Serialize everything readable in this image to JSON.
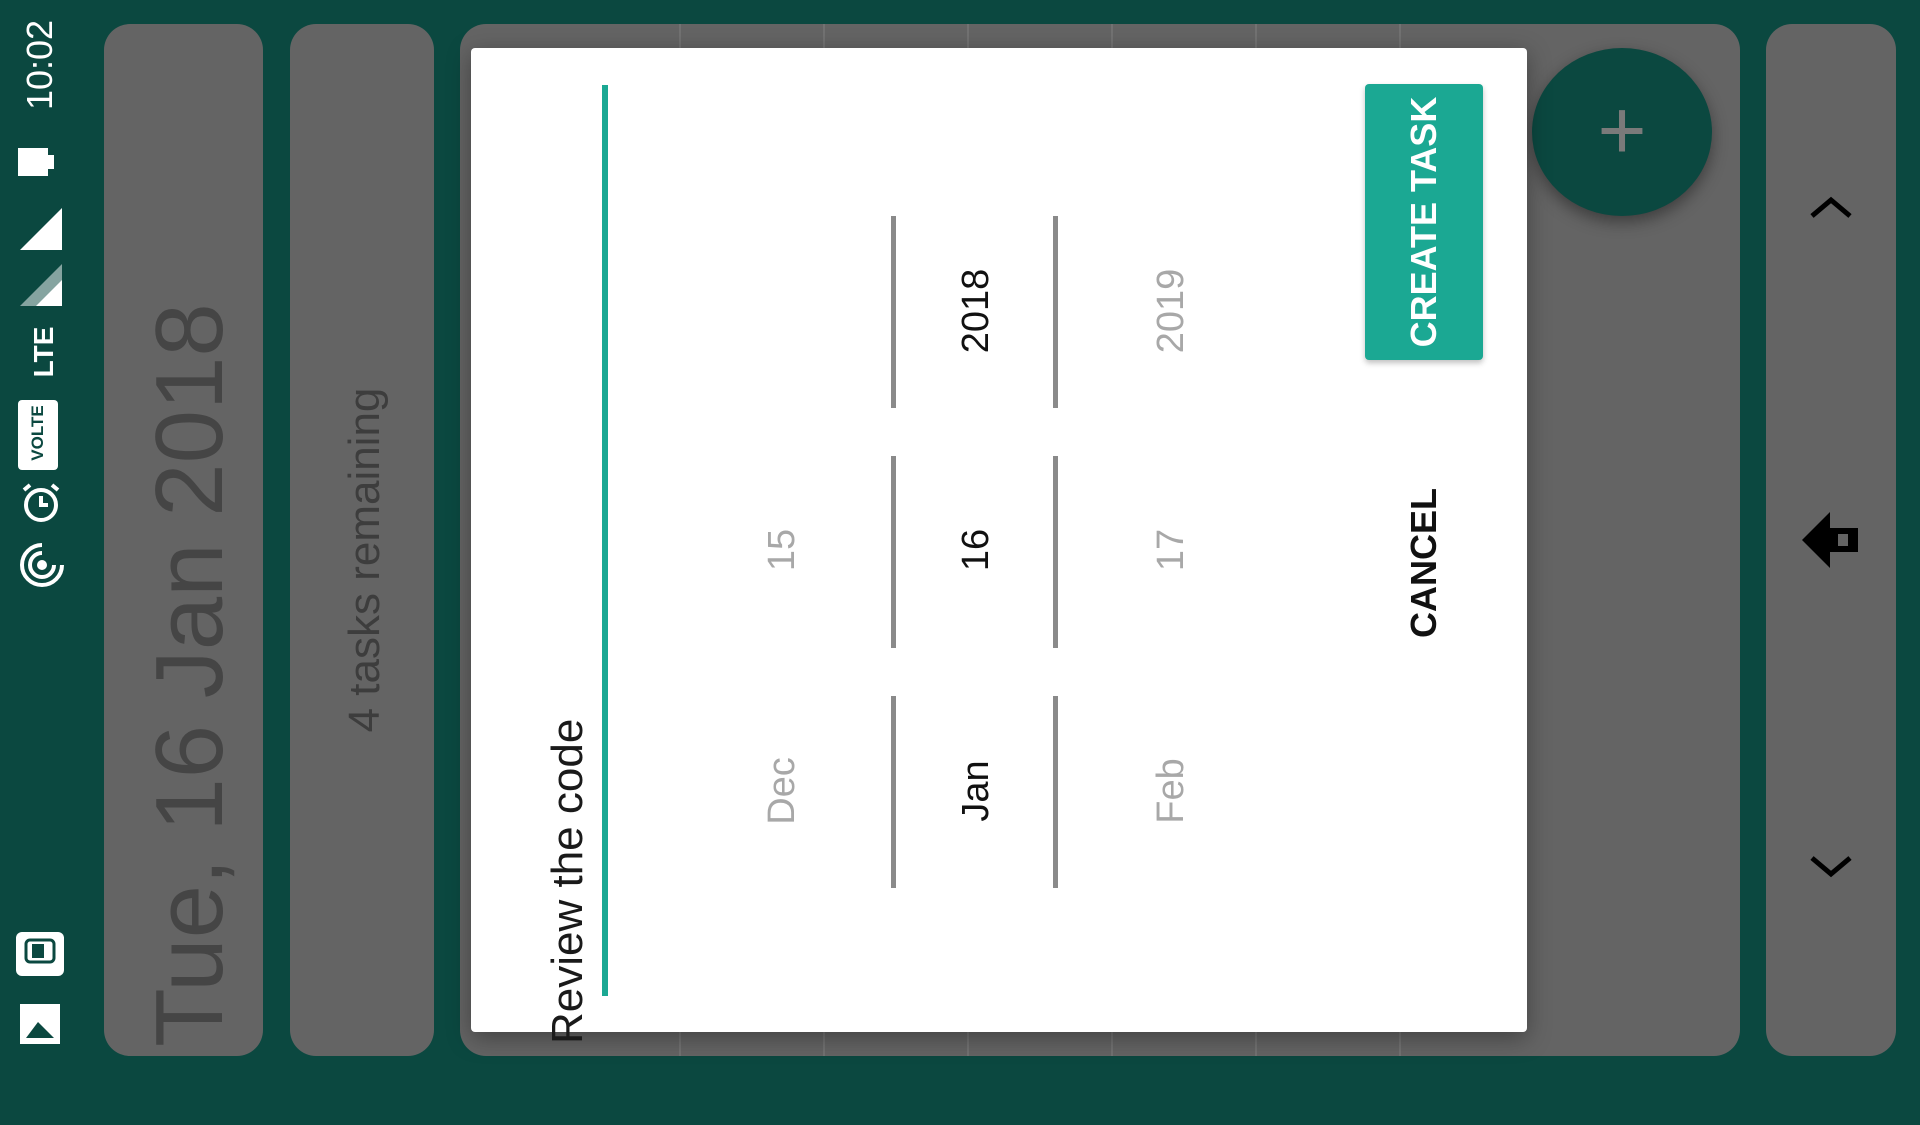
{
  "status_bar": {
    "time": "10:02",
    "network": "LTE",
    "volte_badge": "VOLTE",
    "icons": [
      "photo-icon",
      "app-notification-icon",
      "hotspot-icon",
      "alarm-icon",
      "signal-icon",
      "signal-icon",
      "battery-icon"
    ]
  },
  "header": {
    "date": "Tue, 16 Jan 2018",
    "tasks_remaining": "4 tasks remaining"
  },
  "dialog": {
    "task_input_value": "Review the code",
    "date_picker": {
      "previous": {
        "month": "Dec",
        "day": "15",
        "year": ""
      },
      "selected": {
        "month": "Jan",
        "day": "16",
        "year": "2018"
      },
      "next": {
        "month": "Feb",
        "day": "17",
        "year": "2019"
      }
    },
    "create_label": "CREATE TASK",
    "cancel_label": "CANCEL"
  },
  "fab": {
    "label": "+",
    "icon": "plus-icon"
  },
  "navigation": {
    "icons": [
      "chevron-up-icon",
      "home-icon",
      "chevron-down-icon"
    ]
  },
  "colors": {
    "background": "#0b4840",
    "panel": "#646464",
    "accent": "#1ba893",
    "dialog": "#ffffff"
  }
}
